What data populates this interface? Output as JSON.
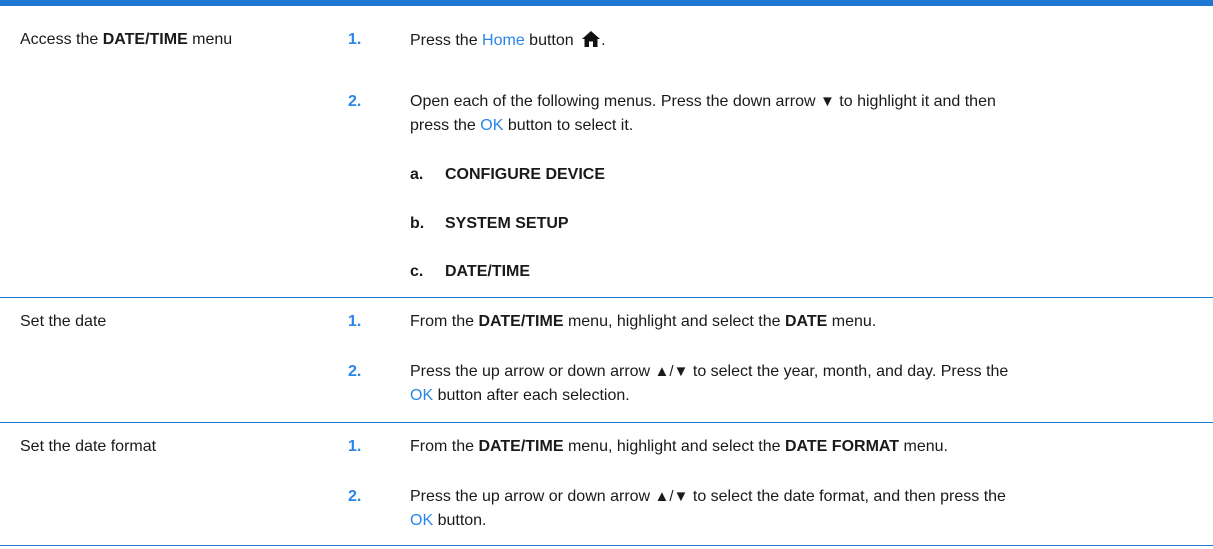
{
  "rows": [
    {
      "action_pre": "Access the ",
      "action_bold": "DATE/TIME",
      "action_post": " menu",
      "steps": [
        {
          "num": "1.",
          "t1": "Press the ",
          "link": "Home",
          "t2": " button ",
          "tail": "."
        },
        {
          "num": "2.",
          "line1_a": "Open each of the following menus. Press the down arrow ",
          "line1_b": " to highlight it and then",
          "line2_a": "press the ",
          "link": "OK",
          "line2_b": " button to select it."
        }
      ],
      "substeps": [
        {
          "letter": "a.",
          "label": "CONFIGURE DEVICE"
        },
        {
          "letter": "b.",
          "label": "SYSTEM SETUP"
        },
        {
          "letter": "c.",
          "label": "DATE/TIME"
        }
      ]
    },
    {
      "action": "Set the date",
      "steps": [
        {
          "num": "1.",
          "t1": "From the ",
          "b1": "DATE/TIME",
          "t2": " menu, highlight and select the ",
          "b2": "DATE",
          "t3": " menu."
        },
        {
          "num": "2.",
          "line1_a": "Press the up arrow or down arrow ",
          "line1_b": " to select the year, month, and day. Press the",
          "link": "OK",
          "line2_b": " button after each selection."
        }
      ]
    },
    {
      "action": "Set the date format",
      "steps": [
        {
          "num": "1.",
          "t1": "From the ",
          "b1": "DATE/TIME",
          "t2": " menu, highlight and select the ",
          "b2": "DATE FORMAT",
          "t3": " menu."
        },
        {
          "num": "2.",
          "line1_a": "Press the up arrow or down arrow ",
          "line1_b": " to select the date format, and then press the",
          "link": "OK",
          "line2_b": " button."
        }
      ]
    }
  ],
  "icons": {
    "home": "home-icon",
    "down_arrow": "▼",
    "up_down_arrow": "▲/▼"
  },
  "colors": {
    "accent": "#1f77d4",
    "link": "#2a86e8"
  }
}
